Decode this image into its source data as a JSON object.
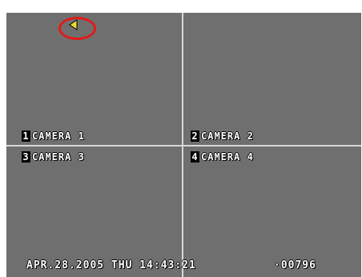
{
  "cameras": [
    {
      "number": "1",
      "name": "CAMERA 1"
    },
    {
      "number": "2",
      "name": "CAMERA 2"
    },
    {
      "number": "3",
      "name": "CAMERA 3"
    },
    {
      "number": "4",
      "name": "CAMERA 4"
    }
  ],
  "status": {
    "date": "APR.28.2005",
    "day": "THU",
    "time": "14:43:21",
    "datetime_text": "APR.28.2005 THU 14:43:21",
    "counter": "·00796"
  },
  "playback": {
    "icon": "reverse-play-icon",
    "highlighted": true,
    "icon_color": "#e8e030",
    "highlight_color": "#e11a1a"
  },
  "colors": {
    "screen_bg": "#6f6f6f",
    "divider": "#d8d8d8",
    "text": "#ffffff"
  }
}
